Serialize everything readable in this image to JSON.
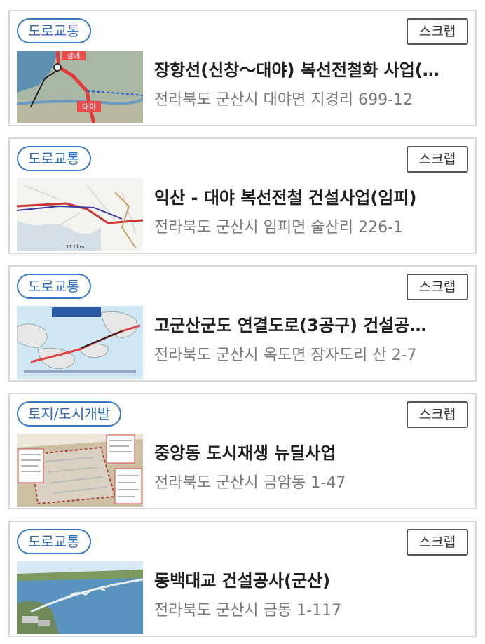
{
  "projects": [
    {
      "category": "도로교통",
      "scrap_label": "스크랩",
      "title": "장항선(신창～대야) 복선전철화 사업(…",
      "address": "전라북도 군산시 대야면 지경리 699-12",
      "thumb_labels": [
        "삼례",
        "대야"
      ]
    },
    {
      "category": "도로교통",
      "scrap_label": "스크랩",
      "title": "익산 - 대야 복선전철 건설사업(임피)",
      "address": "전라북도 군산시 임피면 술산리 226-1"
    },
    {
      "category": "도로교통",
      "scrap_label": "스크랩",
      "title": "고군산군도 연결도로(3공구) 건설공…",
      "address": "전라북도 군산시 옥도면 장자도리 산 2-7"
    },
    {
      "category": "토지/도시개발",
      "scrap_label": "스크랩",
      "title": "중앙동 도시재생 뉴딜사업",
      "address": "전라북도 군산시 금암동 1-47"
    },
    {
      "category": "도로교통",
      "scrap_label": "스크랩",
      "title": "동백대교 건설공사(군산)",
      "address": "전라북도 군산시 금동 1-117"
    }
  ]
}
